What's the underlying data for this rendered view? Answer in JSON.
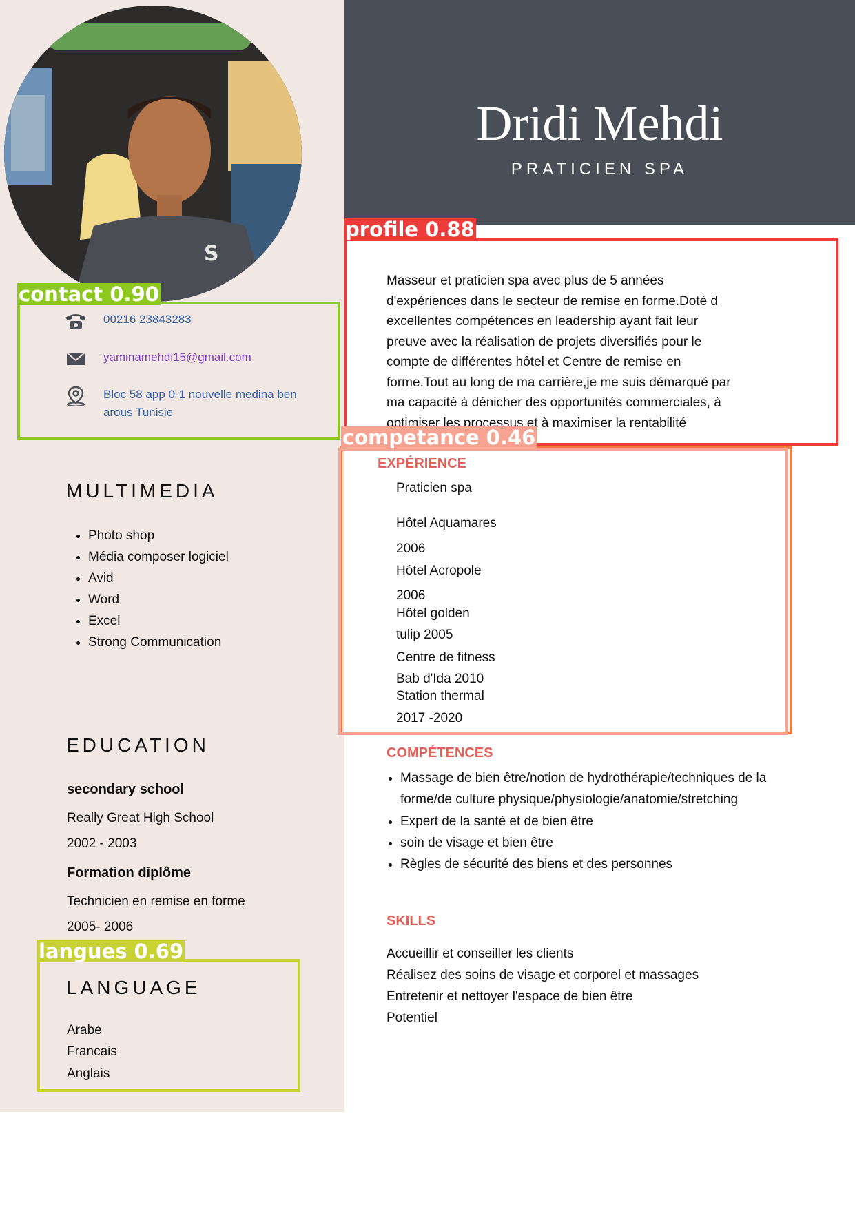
{
  "header": {
    "name": "Dridi Mehdi",
    "title": "PRATICIEN SPA"
  },
  "photo": {
    "alt": "profile photo"
  },
  "contact": {
    "phone": "00216 23843283",
    "email": "yaminamehdi15@gmail.com",
    "address_line1": "Bloc 58 app 0-1 nouvelle medina ben",
    "address_line2": "arous Tunisie",
    "icons": [
      "phone-icon",
      "mail-icon",
      "location-pin-icon"
    ]
  },
  "multimedia": {
    "heading": "MULTIMEDIA",
    "items": [
      "Photo shop",
      "Média composer logiciel",
      "Avid",
      "Word",
      "Excel",
      "Strong Communication"
    ]
  },
  "education": {
    "heading": "EDUCATION",
    "entries": [
      {
        "title": "secondary school",
        "school": "Really Great High School",
        "years": "2002 - 2003"
      },
      {
        "title": "Formation diplôme",
        "school": "Technicien en remise en forme",
        "years": "2005- 2006"
      }
    ]
  },
  "language": {
    "heading": "LANGUAGE",
    "items": [
      "Arabe",
      "Francais",
      "Anglais"
    ]
  },
  "profile": {
    "lines": [
      "Masseur et praticien spa avec plus de 5 années",
      "d'expériences dans le secteur de remise en forme.Doté d",
      "excellentes compétences en leadership ayant fait leur",
      "preuve avec la réalisation de projets diversifiés pour le",
      "compte de différentes hôtel et Centre de remise en",
      "forme.Tout au long de ma carrière,je me suis démarqué par",
      "ma capacité à dénicher des opportunités commerciales, à",
      "optimiser les processus et à maximiser la rentabilité"
    ]
  },
  "experience": {
    "heading": "EXPÉRIENCE",
    "lines": [
      "Praticien spa",
      "Hôtel Aquamares",
      "2006",
      "Hôtel Acropole",
      "2006",
      "Hôtel golden",
      "tulip 2005",
      "Centre de fitness",
      "Bab d'Ida 2010",
      "Station thermal",
      "2017 -2020"
    ]
  },
  "competences": {
    "heading": "COMPÉTENCES",
    "items": [
      "Massage de bien être/notion de hydrothérapie/techniques de la forme/de culture physique/physiologie/anatomie/stretching",
      "Expert de la santé et de bien être",
      "soin de visage et bien être",
      "Règles de sécurité des biens et des personnes"
    ]
  },
  "skills": {
    "heading": "SKILLS",
    "lines": [
      "Accueillir et conseiller les clients",
      "Réalisez des soins de visage et corporel et massages",
      "Entretenir et nettoyer l'espace de bien être",
      "Potentiel"
    ]
  },
  "detections": [
    {
      "label": "profile 0.88",
      "color": "#ee3b3b"
    },
    {
      "label": "contact 0.90",
      "color": "#8cc81e"
    },
    {
      "label": "competance 0.46",
      "color": "#f7a391"
    },
    {
      "label": "langues 0.69",
      "color": "#c8d232"
    }
  ],
  "colors": {
    "accent": "#e0605a",
    "header_bg": "#4a4e57",
    "sidebar_bg": "#f2e8e3"
  }
}
